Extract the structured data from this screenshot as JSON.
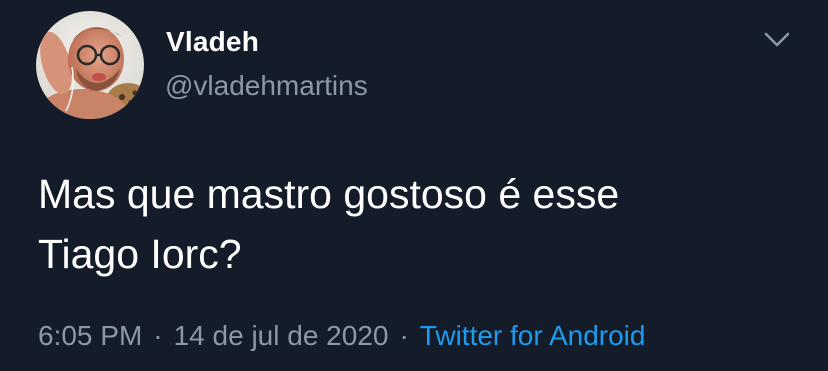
{
  "tweet": {
    "display_name": "Vladeh",
    "handle": "@vladehmartins",
    "text": "Mas que mastro gostoso é esse\nTiago Iorc?",
    "time": "6:05 PM",
    "separator": "·",
    "date": "14 de jul de 2020",
    "source": "Twitter for Android"
  },
  "colors": {
    "background": "#141c29",
    "text_primary": "#ffffff",
    "text_secondary": "#8b98a5",
    "link": "#1d9bf0"
  },
  "icons": {
    "menu": "chevron-down-icon",
    "avatar": "avatar"
  }
}
